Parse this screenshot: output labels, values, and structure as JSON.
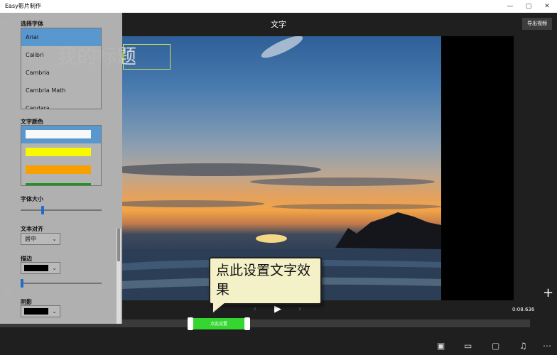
{
  "window": {
    "title": "Easy影片制作",
    "controls": [
      "—",
      "▢",
      "✕"
    ]
  },
  "header": {
    "title": "文字",
    "export_label": "导出视频",
    "back_icon": "back-arrow-icon"
  },
  "overlay": {
    "text": "我的标题"
  },
  "callout": {
    "text": "点此设置文字效果"
  },
  "timeline": {
    "clip_label": "点此设置",
    "time": "0:08.636",
    "clip_color": "#36d631"
  },
  "panel": {
    "font_label": "选择字体",
    "fonts": [
      "Arial",
      "Calibri",
      "Cambria",
      "Cambria Math",
      "Candara"
    ],
    "selected_font": "Arial",
    "color_label": "文字颜色",
    "colors": [
      "#ffffff",
      "#ffff00",
      "#ffa500",
      "#1a9a1a"
    ],
    "selected_color": "#ffffff",
    "size_label": "字体大小",
    "size_level": 0.26,
    "align_label": "文本对齐",
    "align_value": "居中",
    "stroke_label": "描边",
    "stroke_color": "#000000",
    "stroke_level": 0.0,
    "shadow_label": "阴影",
    "shadow_color": "#000000"
  },
  "bottom_icons": [
    "save-icon",
    "display-icon",
    "comment-icon",
    "music-icon",
    "more-icon"
  ]
}
